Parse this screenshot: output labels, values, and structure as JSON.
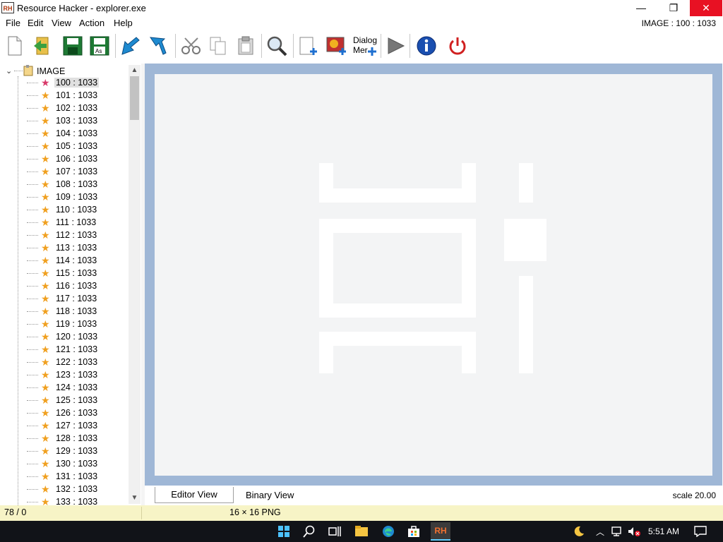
{
  "window": {
    "title": "Resource Hacker - explorer.exe",
    "app_icon": "RH",
    "min_glyph": "—",
    "max_glyph": "❐",
    "close_glyph": "✕"
  },
  "menu": {
    "items": [
      "File",
      "Edit",
      "View",
      "Action",
      "Help"
    ],
    "resource_indicator": "IMAGE : 100 : 1033"
  },
  "toolbar": {
    "dialog_merge_label_1": "Dialog",
    "dialog_merge_label_2": "Mer"
  },
  "tree": {
    "root_label": "IMAGE",
    "items": [
      "100 : 1033",
      "101 : 1033",
      "102 : 1033",
      "103 : 1033",
      "104 : 1033",
      "105 : 1033",
      "106 : 1033",
      "107 : 1033",
      "108 : 1033",
      "109 : 1033",
      "110 : 1033",
      "111 : 1033",
      "112 : 1033",
      "113 : 1033",
      "114 : 1033",
      "115 : 1033",
      "116 : 1033",
      "117 : 1033",
      "118 : 1033",
      "119 : 1033",
      "120 : 1033",
      "121 : 1033",
      "122 : 1033",
      "123 : 1033",
      "124 : 1033",
      "125 : 1033",
      "126 : 1033",
      "127 : 1033",
      "128 : 1033",
      "129 : 1033",
      "130 : 1033",
      "131 : 1033",
      "132 : 1033",
      "133 : 1033"
    ],
    "selected_index": 0
  },
  "tabs": {
    "editor": "Editor View",
    "binary": "Binary View",
    "scale": "scale 20.00"
  },
  "status": {
    "position": "78 / 0",
    "info": "16 × 16  PNG"
  },
  "taskbar": {
    "time": "5:51 AM",
    "rh_label": "RH"
  },
  "colors": {
    "close_red": "#e81123",
    "canvas_border": "#9fb7d6",
    "status_bg": "#f7f4c6"
  }
}
